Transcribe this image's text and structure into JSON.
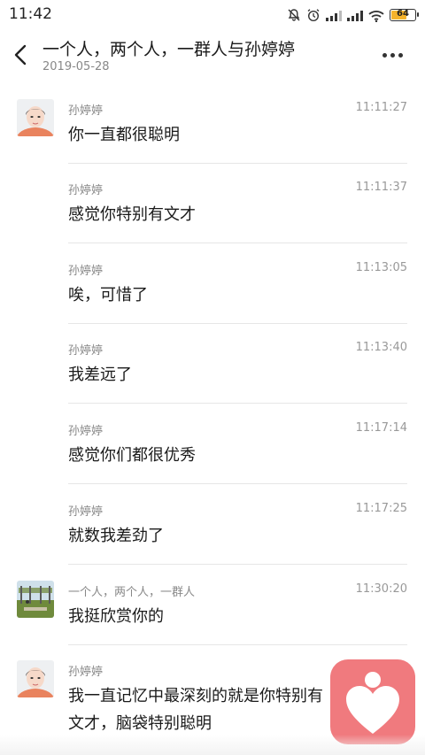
{
  "status": {
    "time": "11:42",
    "battery": "64"
  },
  "header": {
    "title": "一个人，两个人，一群人与孙婷婷",
    "date": "2019-05-28"
  },
  "messages": [
    {
      "sender": "孙婷婷",
      "time": "11:11:27",
      "text": "你一直都很聪明"
    },
    {
      "sender": "孙婷婷",
      "time": "11:11:37",
      "text": "感觉你特别有文才"
    },
    {
      "sender": "孙婷婷",
      "time": "11:13:05",
      "text": "唉，可惜了"
    },
    {
      "sender": "孙婷婷",
      "time": "11:13:40",
      "text": "我差远了"
    },
    {
      "sender": "孙婷婷",
      "time": "11:17:14",
      "text": "感觉你们都很优秀"
    },
    {
      "sender": "孙婷婷",
      "time": "11:17:25",
      "text": "就数我差劲了"
    },
    {
      "sender": "一个人，两个人，一群人",
      "time": "11:30:20",
      "text": "我挺欣赏你的"
    },
    {
      "sender": "孙婷婷",
      "time": "",
      "text": "我一直记忆中最深刻的就是你特别有文才，脑袋特别聪明"
    }
  ]
}
